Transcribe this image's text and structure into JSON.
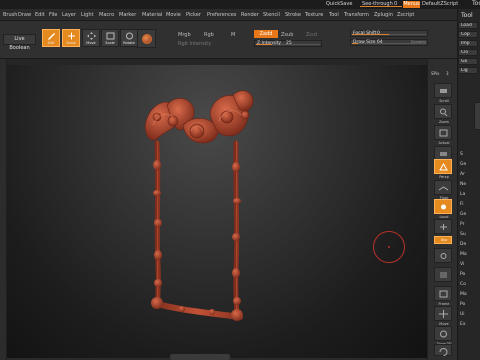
{
  "titlebar": {
    "quicksave": "QuickSave",
    "see_through_label": "See-through",
    "see_through_value": "0",
    "menus": "Menus",
    "script": "DefaultZScript"
  },
  "menubar": {
    "items": [
      "Brush",
      "Draw",
      "Edit",
      "File",
      "Layer",
      "Light",
      "Macro",
      "Marker",
      "Material",
      "Movie",
      "Picker",
      "Preferences",
      "Render",
      "Stencil",
      "Stroke",
      "Texture",
      "Tool",
      "Transform",
      "Zplugin",
      "Zscript"
    ]
  },
  "shelf": {
    "live_boolean": "Live Boolean",
    "edit": "Edit",
    "draw": "Draw",
    "move": "Move",
    "scale": "Scale",
    "rotate": "Rotate",
    "mrgb": "Mrgb",
    "rgb": "Rgb",
    "m": "M",
    "zadd": "Zadd",
    "zsub": "Zsub",
    "zcut": "Zcut",
    "rgb_intensity": "Rgb Intensity",
    "z_intensity_label": "Z Intensity",
    "z_intensity_value": "25",
    "z_intensity_level": 0.25,
    "focal_shift_label": "Focal Shift",
    "focal_shift_value": "0",
    "focal_shift_level": 0.5,
    "draw_size_label": "Draw Size",
    "draw_size_value": "64",
    "draw_size_level": 0.08,
    "dynamic": "Dynamic"
  },
  "right_dock": {
    "spix_label": "SPix",
    "spix_value": "3",
    "buttons": [
      "Scroll",
      "Zoom",
      "Actual",
      "AAHalf",
      "Persp",
      "Floor",
      "Local",
      "",
      "Xyz",
      "",
      "",
      "Frame",
      "Move",
      "Zoom3D",
      "Rotate",
      "Line Fill PolyF"
    ]
  },
  "tool_panel": {
    "title": "Tool",
    "rows": [
      "Load",
      "Cop",
      "Imp",
      "Clo",
      "Go",
      "Lig"
    ],
    "letters": [
      "S",
      "Ge",
      "Ar",
      "Ne",
      "La",
      "Fi",
      "Ge",
      "Pr",
      "Su",
      "De",
      "Ma",
      "Vi",
      "Po",
      "Co",
      "Ma",
      "Po",
      "Ui",
      "Ex"
    ]
  },
  "colors": {
    "accent": "#e8771a",
    "clay": "#b0452e",
    "brush_ring": "#b5322a"
  }
}
